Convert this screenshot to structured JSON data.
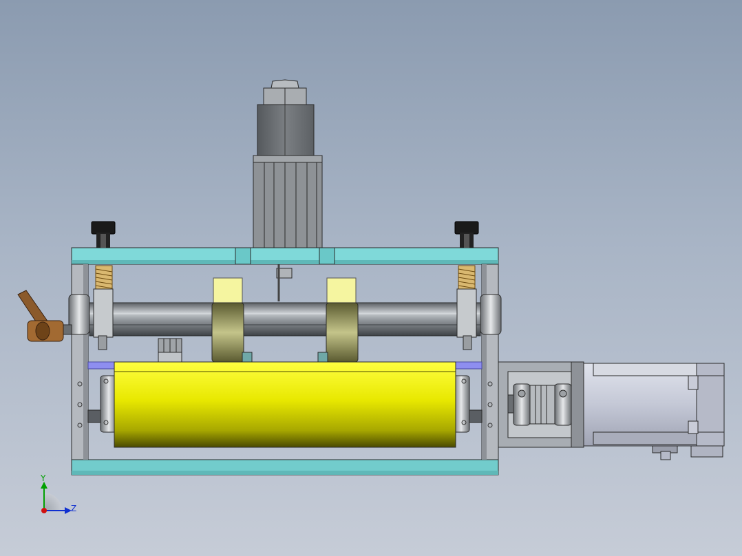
{
  "viewport": {
    "background_top": "#8b9bb0",
    "background_bottom": "#c6ccd7"
  },
  "colors": {
    "frame_plate": "#7fd9d9",
    "frame_plate_dark": "#5fb8b8",
    "side_plate": "#b5b9bf",
    "roller_yellow": "#f0f000",
    "roller_dark": "#4a4a00",
    "pad_yellow": "#f5f5a0",
    "steel": "#9ea3a8",
    "steel_dark": "#5a5e63",
    "cylinder_body": "#6d7175",
    "handle_brown": "#8b5a2b",
    "spring": "#c8a050",
    "motor_body": "#c8ccda",
    "strip_blue": "#8e8ef0"
  },
  "assembly": {
    "components": [
      "air-cylinder",
      "top-frame-plate",
      "bottom-frame-plate",
      "left-side-plate",
      "right-side-plate",
      "adjustment-knob-left",
      "adjustment-knob-right",
      "compression-spring-left",
      "compression-spring-right",
      "press-shaft",
      "pinch-roller-left",
      "pinch-roller-right",
      "drive-roller",
      "flexible-coupling",
      "coupling-bracket",
      "servo-motor",
      "clamp-lever"
    ]
  },
  "triad": {
    "y_label": "Y",
    "z_label": "Z",
    "y_color": "#00a000",
    "z_color": "#1030d0",
    "x_color": "#d01010"
  }
}
